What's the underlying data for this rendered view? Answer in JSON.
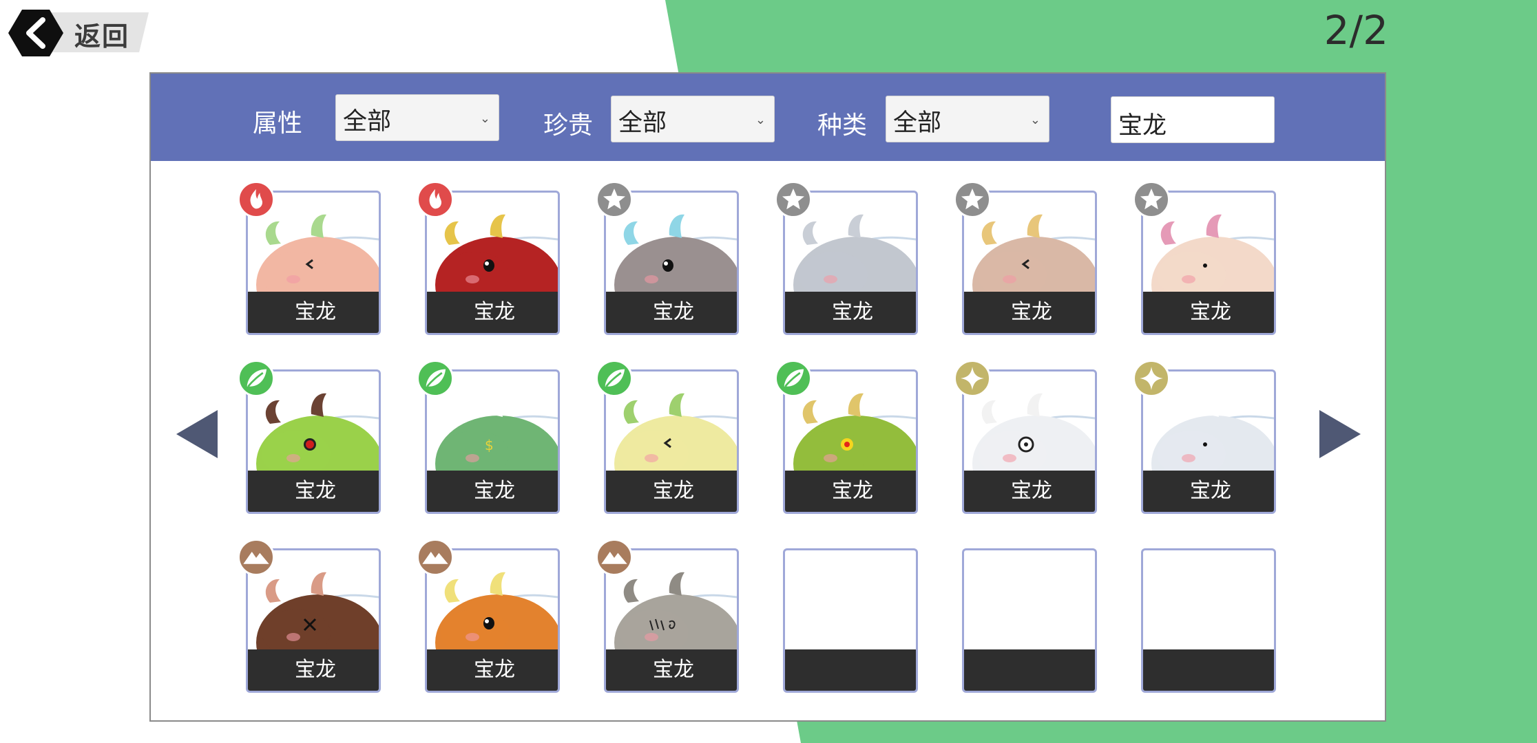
{
  "header": {
    "back_label": "返回",
    "page_indicator": "2/2"
  },
  "filters": {
    "attribute_label": "属性",
    "attribute_value": "全部",
    "rarity_label": "珍贵",
    "rarity_value": "全部",
    "species_label": "种类",
    "species_value": "全部",
    "search_value": "宝龙"
  },
  "colors": {
    "background_green": "#6ccb88",
    "filter_bar": "#6171b7",
    "fire": "#e04b4b",
    "normal": "#8e8e8e",
    "grass": "#4fbf56",
    "light": "#c2b56a",
    "earth": "#a87c5e"
  },
  "cards": [
    {
      "name": "宝龙",
      "element": "fire",
      "element_icon": "flame-icon",
      "body": "#f2b7a3",
      "horn": "#a9d98e",
      "face": "wink"
    },
    {
      "name": "宝龙",
      "element": "fire",
      "element_icon": "flame-icon",
      "body": "#b52323",
      "horn": "#e6c44a",
      "face": "eye"
    },
    {
      "name": "宝龙",
      "element": "normal",
      "element_icon": "star-icon",
      "body": "#9a9090",
      "horn": "#8fd6e6",
      "face": "eye"
    },
    {
      "name": "宝龙",
      "element": "normal",
      "element_icon": "star-icon",
      "body": "#c2c7cf",
      "horn": "#c9ced6",
      "face": "none"
    },
    {
      "name": "宝龙",
      "element": "normal",
      "element_icon": "star-icon",
      "body": "#d9b8a6",
      "horn": "#e8c67a",
      "face": "wink"
    },
    {
      "name": "宝龙",
      "element": "normal",
      "element_icon": "star-icon",
      "body": "#f3d9c9",
      "horn": "#e59ab7",
      "face": "dot"
    },
    {
      "name": "宝龙",
      "element": "grass",
      "element_icon": "leaf-icon",
      "body": "#9ad14a",
      "horn": "#6b4233",
      "face": "red-eye"
    },
    {
      "name": "宝龙",
      "element": "grass",
      "element_icon": "leaf-icon",
      "body": "#6fb574",
      "horn": "#ffffff",
      "face": "dollar"
    },
    {
      "name": "宝龙",
      "element": "grass",
      "element_icon": "leaf-icon",
      "body": "#eeeaa0",
      "horn": "#9ed06e",
      "face": "wink"
    },
    {
      "name": "宝龙",
      "element": "grass",
      "element_icon": "leaf-icon",
      "body": "#93bd3c",
      "horn": "#e0c56a",
      "face": "yellow-eye"
    },
    {
      "name": "宝龙",
      "element": "light",
      "element_icon": "sparkle-icon",
      "body": "#eef0f3",
      "horn": "#f2f2f2",
      "face": "ring"
    },
    {
      "name": "宝龙",
      "element": "light",
      "element_icon": "sparkle-icon",
      "body": "#e4e9ef",
      "horn": "#ffffff",
      "face": "dot"
    },
    {
      "name": "宝龙",
      "element": "earth",
      "element_icon": "mountain-icon",
      "body": "#6f3f2a",
      "horn": "#d99b86",
      "face": "cross"
    },
    {
      "name": "宝龙",
      "element": "earth",
      "element_icon": "mountain-icon",
      "body": "#e3822e",
      "horn": "#f0e07a",
      "face": "eye"
    },
    {
      "name": "宝龙",
      "element": "earth",
      "element_icon": "mountain-icon",
      "body": "#a8a49c",
      "horn": "#8f8b84",
      "face": "scribble"
    },
    {
      "name": "",
      "element": "",
      "element_icon": "",
      "body": "",
      "horn": "",
      "face": "empty"
    },
    {
      "name": "",
      "element": "",
      "element_icon": "",
      "body": "",
      "horn": "",
      "face": "empty"
    },
    {
      "name": "",
      "element": "",
      "element_icon": "",
      "body": "",
      "horn": "",
      "face": "empty"
    }
  ]
}
